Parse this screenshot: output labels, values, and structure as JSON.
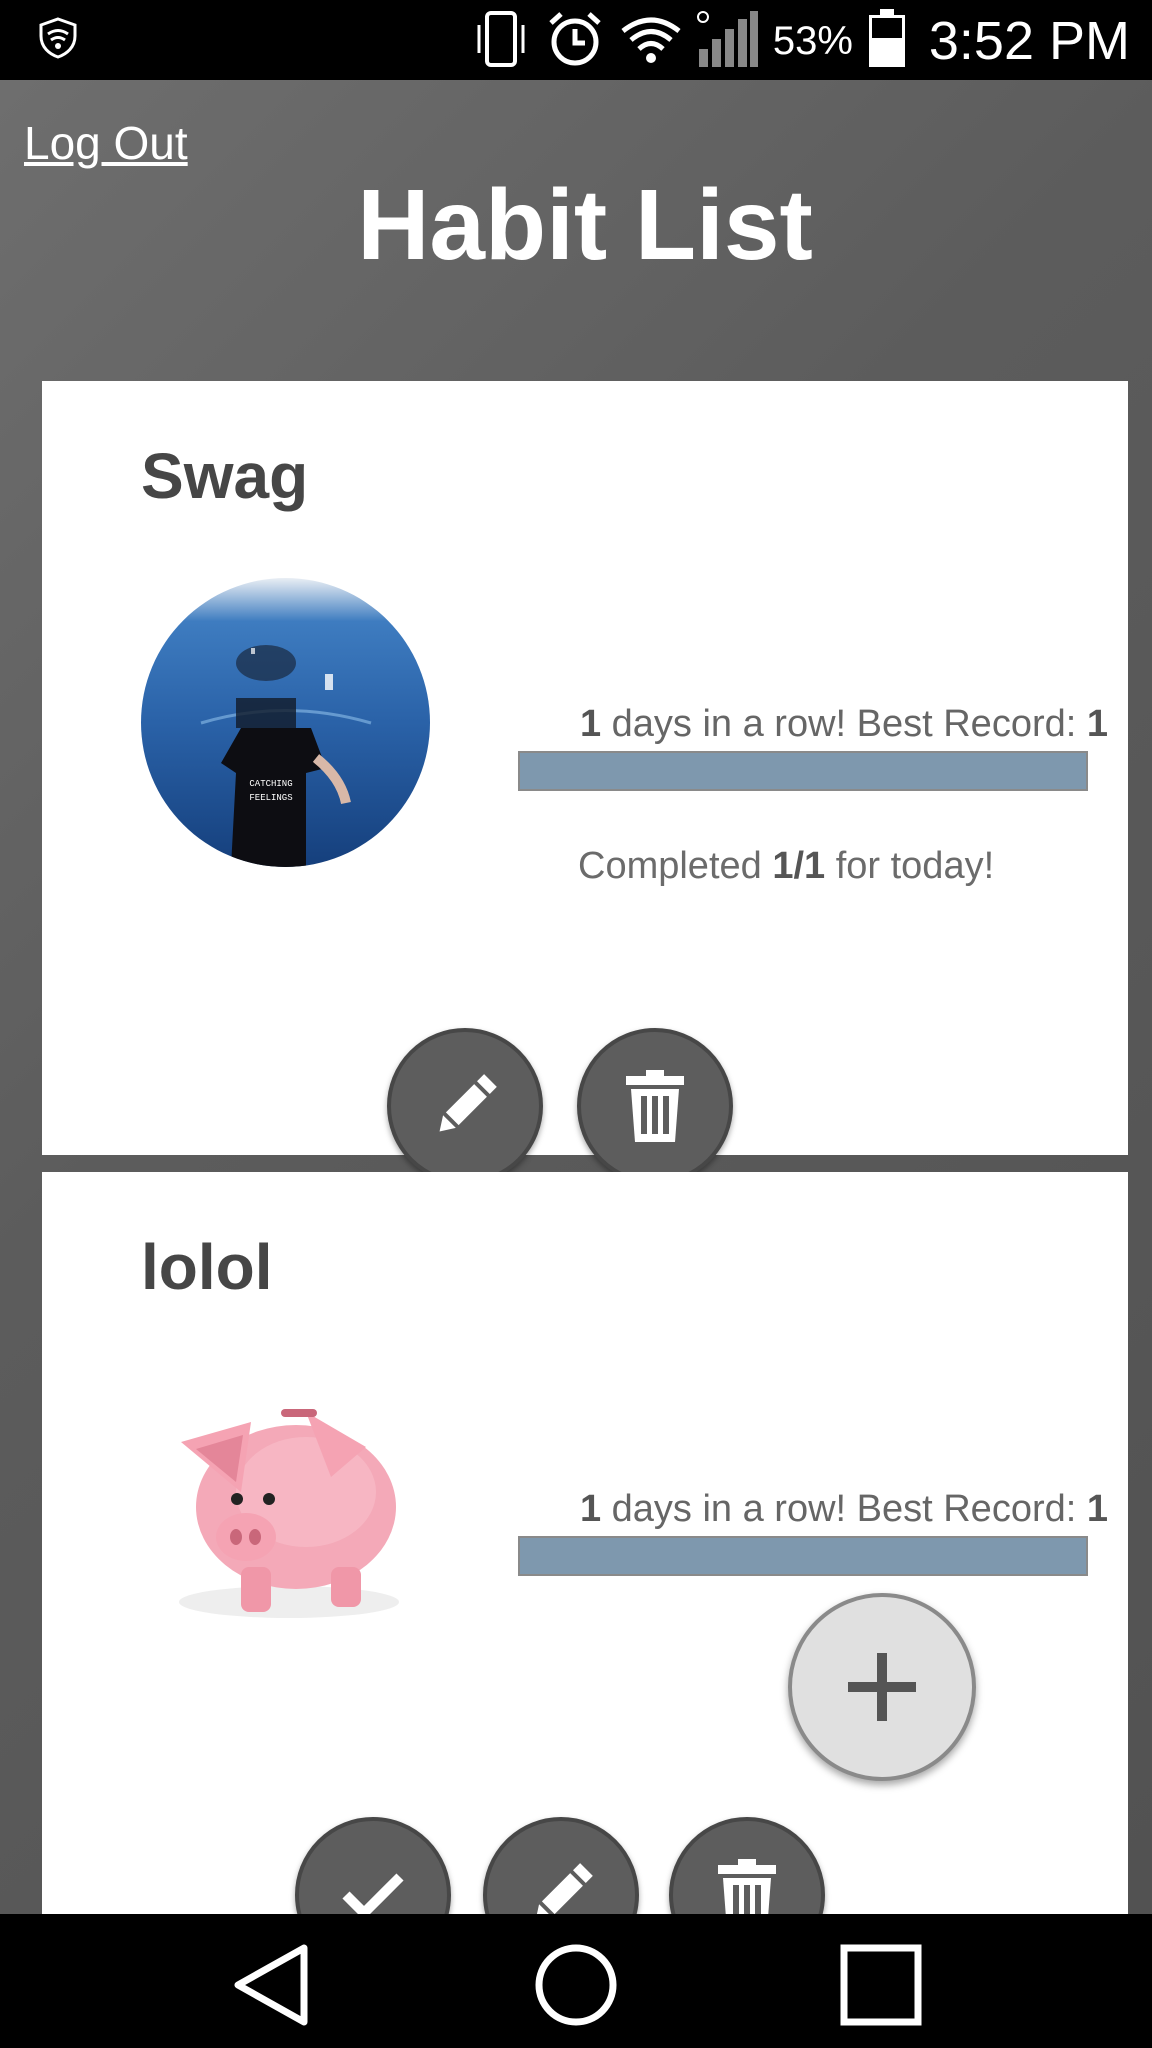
{
  "status_bar": {
    "battery_percent": "53%",
    "time": "3:52 PM",
    "icons": [
      "shield-icon",
      "vibrate-icon",
      "alarm-icon",
      "wifi-icon",
      "signal-icon",
      "battery-icon"
    ]
  },
  "header": {
    "logout_label": "Log Out",
    "title": "Habit List"
  },
  "habits": [
    {
      "name": "Swag",
      "image": "underwater-person-photo",
      "streak_count": "1",
      "streak_text": " days in a row! Best Record: ",
      "best_record": "1",
      "progress": 1.0,
      "completed_prefix": "Completed ",
      "completed_value": "1/1",
      "completed_suffix": " for today!",
      "actions": [
        "edit",
        "delete"
      ]
    },
    {
      "name": "lolol",
      "image": "piggy-bank-photo",
      "streak_count": "1",
      "streak_text": " days in a row! Best Record: ",
      "best_record": "1",
      "progress": 1.0,
      "actions": [
        "done",
        "edit",
        "delete"
      ]
    }
  ],
  "fab": {
    "icon": "plus-icon"
  },
  "nav_bar": {
    "icons": [
      "back-icon",
      "home-icon",
      "recents-icon"
    ]
  },
  "colors": {
    "progress_fill": "#7e98ae",
    "button_fill": "#5d5d5d",
    "fab_fill": "#e0e0e0"
  }
}
